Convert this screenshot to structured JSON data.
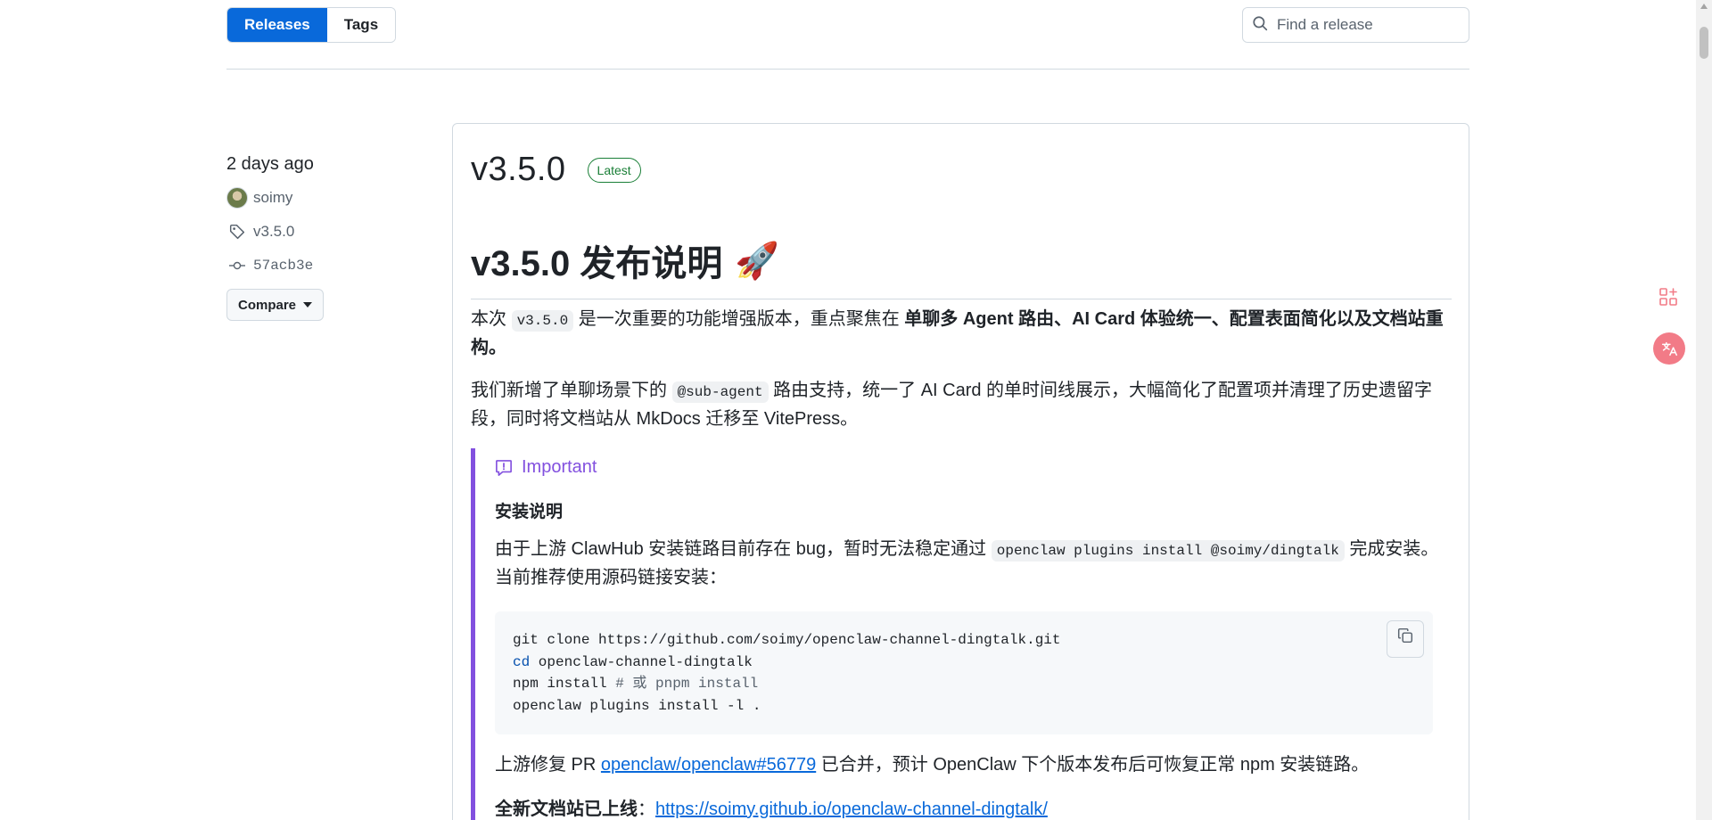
{
  "tabs": {
    "releases": "Releases",
    "tags": "Tags"
  },
  "search": {
    "placeholder": "Find a release"
  },
  "sidebar": {
    "date": "2 days ago",
    "author": "soimy",
    "tag": "v3.5.0",
    "commit": "57acb3e",
    "compare_label": "Compare"
  },
  "release": {
    "version": "v3.5.0",
    "badge": "Latest",
    "heading": "v3.5.0 发布说明",
    "heading_emoji": "🚀",
    "p1": {
      "a": "本次 ",
      "code": "v3.5.0",
      "b": " 是一次重要的功能增强版本，重点聚焦在 ",
      "bold": "单聊多 Agent 路由、AI Card 体验统一、配置表面简化以及文档站重构。"
    },
    "p2": {
      "a": "我们新增了单聊场景下的 ",
      "code": "@sub-agent",
      "b": " 路由支持，统一了 AI Card 的单时间线展示，大幅简化了配置项并清理了历史遗留字段，同时将文档站从 MkDocs 迁移至 VitePress。"
    },
    "callout": {
      "title": "Important",
      "heading": "安装说明",
      "p1": {
        "a": "由于上游 ClawHub 安装链路目前存在 bug，暂时无法稳定通过 ",
        "code": "openclaw plugins install @soimy/dingtalk",
        "b": " 完成安装。当前推荐使用源码链接安装："
      },
      "code_lines": {
        "l1": "git clone https://github.com/soimy/openclaw-channel-dingtalk.git",
        "l2_kw": "cd",
        "l2_rest": " openclaw-channel-dingtalk",
        "l3": "npm install ",
        "l3_comment": "# 或 pnpm install",
        "l4": "openclaw plugins install -l ."
      },
      "p2": {
        "a": "上游修复 PR ",
        "link": "openclaw/openclaw#56779",
        "b": " 已合并，预计 OpenClaw 下个版本发布后可恢复正常 npm 安装链路。"
      },
      "p3": {
        "bold": "全新文档站已上线",
        "a": "：",
        "link": "https://soimy.github.io/openclaw-channel-dingtalk/"
      }
    }
  },
  "colors": {
    "accent": "#0969da",
    "important": "#8250df",
    "latest": "#1a7f37"
  },
  "icons": [
    "search-icon",
    "tag-icon",
    "commit-icon",
    "caret-down-icon",
    "report-icon",
    "copy-icon",
    "apps-icon",
    "translate-icon"
  ]
}
